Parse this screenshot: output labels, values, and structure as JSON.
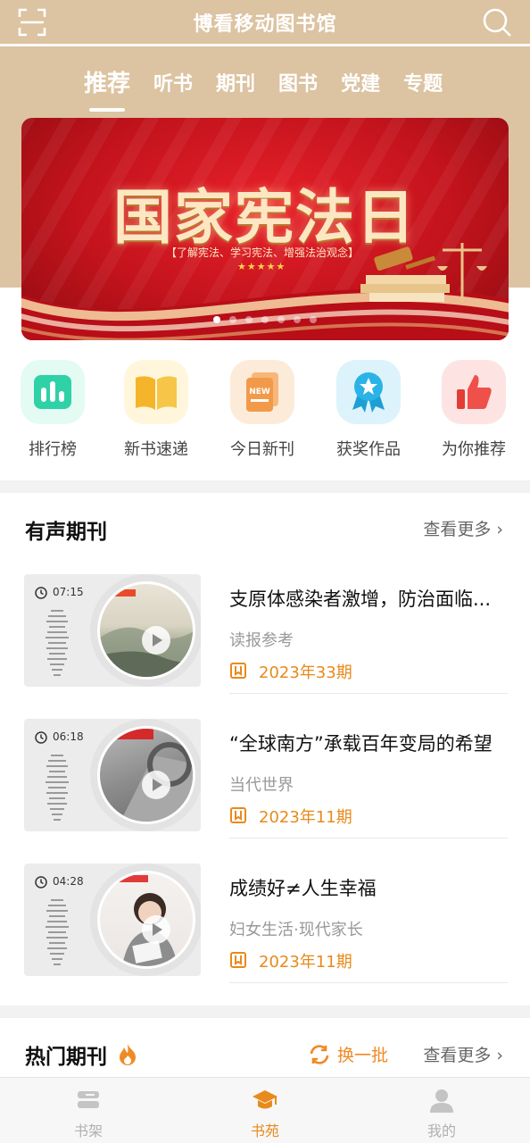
{
  "app": {
    "title": "博看移动图书馆"
  },
  "tabs": [
    {
      "label": "推荐",
      "active": true
    },
    {
      "label": "听书",
      "active": false
    },
    {
      "label": "期刊",
      "active": false
    },
    {
      "label": "图书",
      "active": false
    },
    {
      "label": "党建",
      "active": false
    },
    {
      "label": "专题",
      "active": false
    }
  ],
  "banner": {
    "title": "国家宪法日",
    "subtitle": "【了解宪法、学习宪法、增强法治观念】",
    "stars": "★★★★★",
    "slide_count": 7,
    "active_slide": 1
  },
  "shortcuts": [
    {
      "label": "排行榜",
      "icon": "ranking-icon",
      "color": "#2fd1a6"
    },
    {
      "label": "新书速递",
      "icon": "open-book-icon",
      "color": "#f5b52a"
    },
    {
      "label": "今日新刊",
      "icon": "new-magazine-icon",
      "color": "#f29a4a"
    },
    {
      "label": "获奖作品",
      "icon": "award-icon",
      "color": "#2bb3e8"
    },
    {
      "label": "为你推荐",
      "icon": "thumbs-up-icon",
      "color": "#f0504a"
    }
  ],
  "audio_section": {
    "title": "有声期刊",
    "more": "查看更多",
    "items": [
      {
        "duration": "07:15",
        "title": "支原体感染者激增，防治面临...",
        "source": "读报参考",
        "issue": "2023年33期"
      },
      {
        "duration": "06:18",
        "title": "“全球南方”承载百年变局的希望",
        "source": "当代世界",
        "issue": "2023年11期"
      },
      {
        "duration": "04:28",
        "title": "成绩好≠人生幸福",
        "source": "妇女生活·现代家长",
        "issue": "2023年11期"
      }
    ]
  },
  "hot_section": {
    "title": "热门期刊",
    "swap": "换一批",
    "more": "查看更多"
  },
  "bottom_nav": [
    {
      "label": "书架",
      "icon": "bookshelf-icon",
      "active": false
    },
    {
      "label": "书苑",
      "icon": "graduation-cap-icon",
      "active": true
    },
    {
      "label": "我的",
      "icon": "user-icon",
      "active": false
    }
  ],
  "colors": {
    "header": "#dcc3a1",
    "accent": "#e88a1c"
  }
}
